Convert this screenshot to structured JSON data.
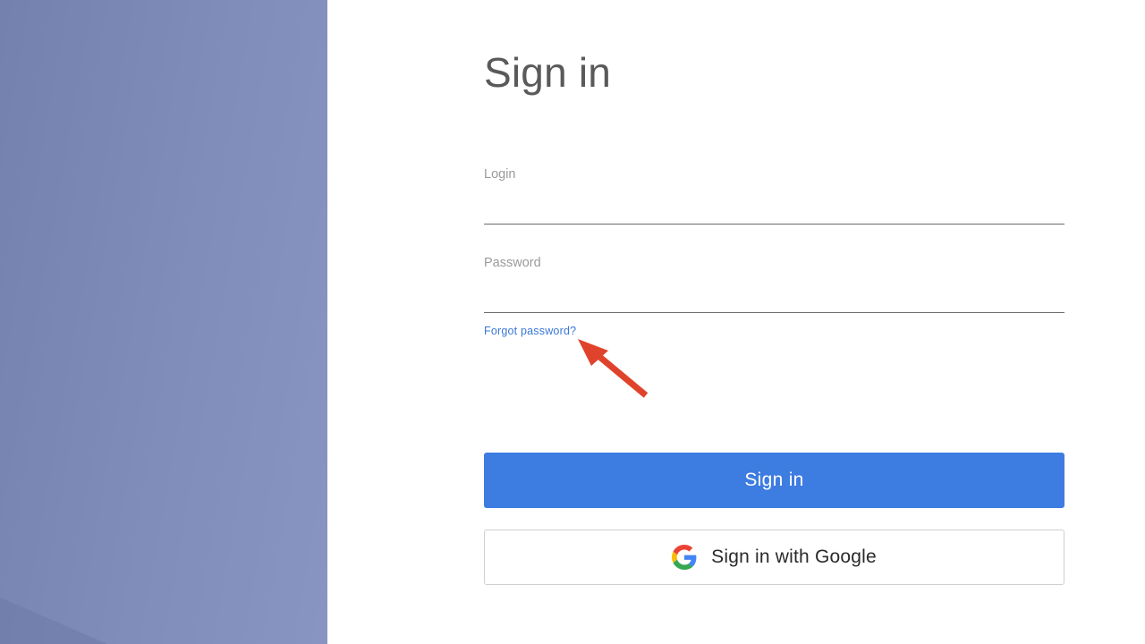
{
  "form": {
    "title": "Sign in",
    "login": {
      "label": "Login",
      "value": "",
      "placeholder": ""
    },
    "password": {
      "label": "Password",
      "value": "",
      "placeholder": ""
    },
    "forgot_password": "Forgot password?",
    "sign_in_button": "Sign in",
    "google_button": "Sign in with Google"
  },
  "annotation": {
    "icon": "arrow-pointer",
    "color": "#e0432b"
  },
  "colors": {
    "side_panel": "#808dba",
    "primary": "#3d7ce1",
    "link": "#3a78d6"
  },
  "icons": {
    "google": "google-g-icon"
  }
}
